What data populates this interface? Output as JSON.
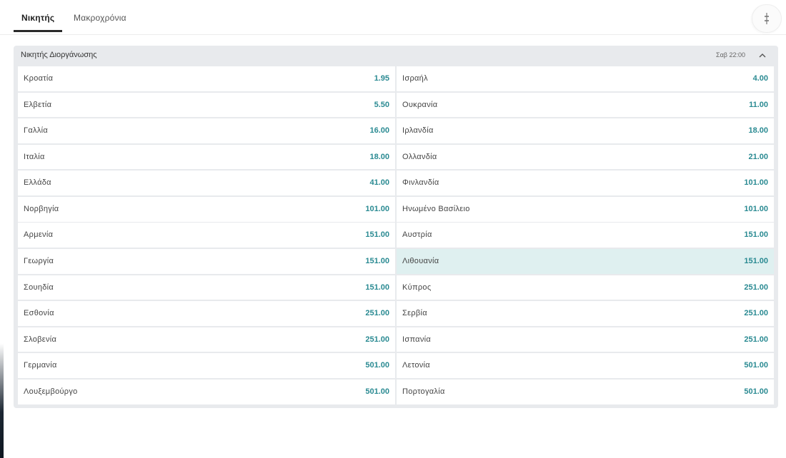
{
  "tabs": [
    {
      "label": "Νικητής",
      "active": true
    },
    {
      "label": "Μακροχρόνια",
      "active": false
    }
  ],
  "market": {
    "title": "Νικητής Διοργάνωσης",
    "time": "Σαβ 22:00",
    "left": [
      {
        "name": "Κροατία",
        "odds": "1.95"
      },
      {
        "name": "Ελβετία",
        "odds": "5.50"
      },
      {
        "name": "Γαλλία",
        "odds": "16.00"
      },
      {
        "name": "Ιταλία",
        "odds": "18.00"
      },
      {
        "name": "Ελλάδα",
        "odds": "41.00"
      },
      {
        "name": "Νορβηγία",
        "odds": "101.00"
      },
      {
        "name": "Αρμενία",
        "odds": "151.00"
      },
      {
        "name": "Γεωργία",
        "odds": "151.00"
      },
      {
        "name": "Σουηδία",
        "odds": "151.00"
      },
      {
        "name": "Εσθονία",
        "odds": "251.00"
      },
      {
        "name": "Σλοβενία",
        "odds": "251.00"
      },
      {
        "name": "Γερμανία",
        "odds": "501.00"
      },
      {
        "name": "Λουξεμβούργο",
        "odds": "501.00"
      }
    ],
    "right": [
      {
        "name": "Ισραήλ",
        "odds": "4.00"
      },
      {
        "name": "Ουκρανία",
        "odds": "11.00"
      },
      {
        "name": "Ιρλανδία",
        "odds": "18.00"
      },
      {
        "name": "Ολλανδία",
        "odds": "21.00"
      },
      {
        "name": "Φινλανδία",
        "odds": "101.00"
      },
      {
        "name": "Ηνωμένο Βασίλειο",
        "odds": "101.00"
      },
      {
        "name": "Αυστρία",
        "odds": "151.00"
      },
      {
        "name": "Λιθουανία",
        "odds": "151.00",
        "highlighted": true
      },
      {
        "name": "Κύπρος",
        "odds": "251.00"
      },
      {
        "name": "Σερβία",
        "odds": "251.00"
      },
      {
        "name": "Ισπανία",
        "odds": "251.00"
      },
      {
        "name": "Λετονία",
        "odds": "501.00"
      },
      {
        "name": "Πορτογαλία",
        "odds": "501.00"
      }
    ]
  },
  "icons": {
    "filter": "filter-sliders-icon",
    "collapse": "chevron-up-icon"
  },
  "colors": {
    "odds": "#2a8a92",
    "highlight_row": "#dff0f0",
    "panel_bg": "#e8eaed"
  }
}
